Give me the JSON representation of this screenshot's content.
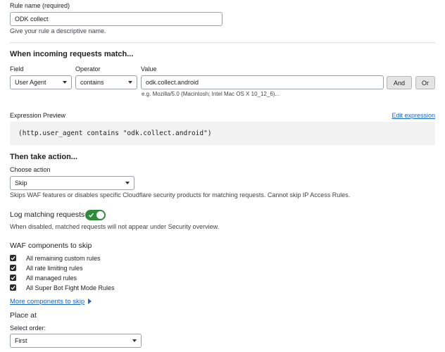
{
  "rule_name": {
    "label": "Rule name (required)",
    "value": "ODK collect",
    "help": "Give your rule a descriptive name."
  },
  "match": {
    "heading": "When incoming requests match...",
    "field_label": "Field",
    "field_value": "User Agent",
    "operator_label": "Operator",
    "operator_value": "contains",
    "value_label": "Value",
    "value_value": "odk.collect.android",
    "value_example": "e.g. Mozilla/5.0 (Macintosh; Intel Mac OS X 10_12_6)...",
    "and_label": "And",
    "or_label": "Or"
  },
  "expression": {
    "label": "Expression Preview",
    "edit_label": "Edit expression",
    "code": "(http.user_agent contains \"odk.collect.android\")"
  },
  "action": {
    "heading": "Then take action...",
    "choose_label": "Choose action",
    "value": "Skip",
    "help": "Skips WAF features or disables specific Cloudflare security products for matching requests. Cannot skip IP Access Rules."
  },
  "logging": {
    "label": "Log matching requests",
    "enabled": true,
    "help": "When disabled, matched requests will not appear under Security overview."
  },
  "waf": {
    "heading": "WAF components to skip",
    "items": [
      {
        "label": "All remaining custom rules",
        "checked": true
      },
      {
        "label": "All rate limiting rules",
        "checked": true
      },
      {
        "label": "All managed rules",
        "checked": true
      },
      {
        "label": "All Super Bot Fight Mode Rules",
        "checked": true
      }
    ],
    "more_label": "More components to skip"
  },
  "place": {
    "heading": "Place at",
    "order_label": "Select order:",
    "order_value": "First"
  },
  "colors": {
    "link": "#1a63c8",
    "toggle_on": "#2f8a3a",
    "checkbox": "#2b2b2b"
  }
}
